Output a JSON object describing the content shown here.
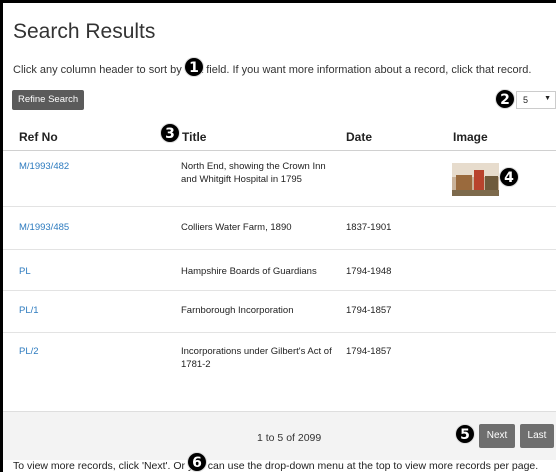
{
  "page": {
    "title": "Search Results"
  },
  "intro": "Click any column header to sort by that field. If you want more information about a record, click that record.",
  "toolbar": {
    "refine_label": "Refine Search",
    "per_page_value": "5"
  },
  "table": {
    "headers": {
      "ref": "Ref No",
      "title": "Title",
      "date": "Date",
      "image": "Image"
    },
    "rows": [
      {
        "ref": "M/1993/482",
        "title": "North End, showing the Crown Inn and Whitgift Hospital in 1795",
        "date": "",
        "has_image": true
      },
      {
        "ref": "M/1993/485",
        "title": "Colliers Water Farm, 1890",
        "date": "1837-1901",
        "has_image": false
      },
      {
        "ref": "PL",
        "title": "Hampshire Boards of Guardians",
        "date": "1794-1948",
        "has_image": false
      },
      {
        "ref": "PL/1",
        "title": "Farnborough Incorporation",
        "date": "1794-1857",
        "has_image": false
      },
      {
        "ref": "PL/2",
        "title": "Incorporations under Gilbert's Act of 1781-2",
        "date": "1794-1857",
        "has_image": false
      }
    ]
  },
  "pager": {
    "info": "1 to 5 of 2099",
    "next_label": "Next",
    "last_label": "Last"
  },
  "help_text": "To view more records, click 'Next'. Or you can use the drop-down menu at the top to view more records per page.",
  "annotations": [
    "1",
    "2",
    "3",
    "4",
    "5",
    "6"
  ],
  "colors": {
    "link": "#2d7bbf",
    "button": "#6e6e6e",
    "badge": "#000000"
  }
}
